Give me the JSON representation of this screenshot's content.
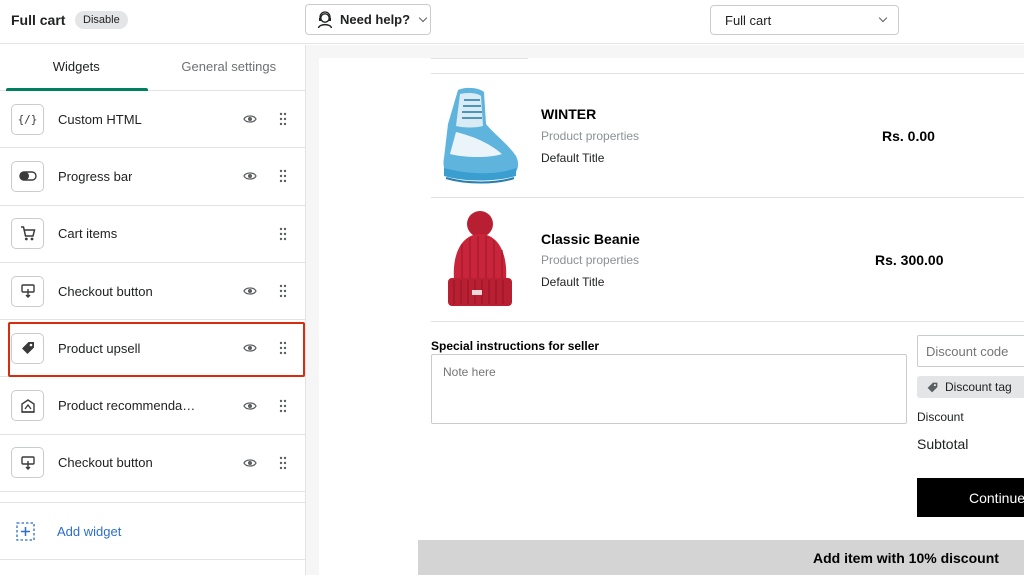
{
  "header": {
    "title": "Full cart",
    "badge": "Disable",
    "help_button": "Need help?",
    "template_select": "Full cart"
  },
  "sidebar": {
    "tabs": [
      {
        "label": "Widgets",
        "active": true
      },
      {
        "label": "General settings",
        "active": false
      }
    ],
    "widgets": [
      {
        "label": "Custom HTML",
        "icon": "code-icon",
        "visible_toggle": true
      },
      {
        "label": "Progress bar",
        "icon": "toggle-icon",
        "visible_toggle": true
      },
      {
        "label": "Cart items",
        "icon": "cart-icon",
        "visible_toggle": false
      },
      {
        "label": "Checkout button",
        "icon": "checkout-icon",
        "visible_toggle": true
      },
      {
        "label": "Product upsell",
        "icon": "tag-icon",
        "visible_toggle": true,
        "highlighted": true
      },
      {
        "label": "Product recommendat…",
        "icon": "recommendation-icon",
        "visible_toggle": true
      },
      {
        "label": "Checkout button",
        "icon": "checkout-icon",
        "visible_toggle": true
      }
    ],
    "add_widget": "Add widget"
  },
  "preview": {
    "items": [
      {
        "name": "WINTER",
        "properties": "Product properties",
        "variant": "Default Title",
        "price": "Rs. 0.00"
      },
      {
        "name": "Classic Beanie",
        "properties": "Product properties",
        "variant": "Default Title",
        "price": "Rs. 300.00"
      }
    ],
    "instructions_label": "Special instructions for seller",
    "note_placeholder": "Note here",
    "discount_placeholder": "Discount code",
    "discount_tag": "Discount tag",
    "discount_label": "Discount",
    "subtotal_label": "Subtotal",
    "continue_button": "Continue",
    "upsell_banner": "Add item with 10% discount"
  },
  "colors": {
    "accent_tab": "#008060",
    "highlight_border": "#d72c0d",
    "link": "#2c6ecb",
    "beanie": "#c8253a",
    "boot": "#5fb4dd"
  }
}
